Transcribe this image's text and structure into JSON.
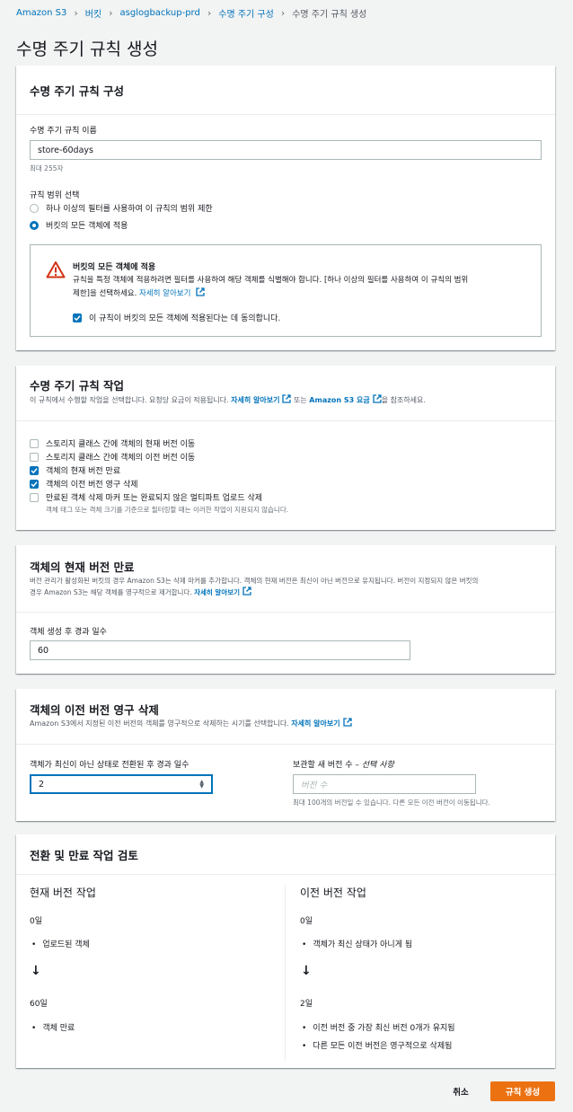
{
  "breadcrumb": [
    {
      "label": "Amazon S3"
    },
    {
      "label": "버킷"
    },
    {
      "label": "asglogbackup-prd"
    },
    {
      "label": "수명 주기 구성"
    },
    {
      "label": "수명 주기 규칙 생성"
    }
  ],
  "page_title": "수명 주기 규칙 생성",
  "config": {
    "title": "수명 주기 규칙 구성",
    "name_label": "수명 주기 규칙 이름",
    "name_value": "store-60days",
    "name_hint": "최대 255자",
    "scope_label": "규칙 범위 선택",
    "scope_options": [
      {
        "label": "하나 이상의 필터를 사용하여 이 규칙의 범위 제한",
        "selected": false
      },
      {
        "label": "버킷의 모든 객체에 적용",
        "selected": true
      }
    ],
    "warning": {
      "title": "버킷의 모든 객체에 적용",
      "body_line1": "규칙을 특정 객체에 적용하려면 필터를 사용하여 해당 객체를 식별해야 합니다. [하나 이상의 필터를 사용하여 이 규칙의 범위",
      "body_line2": "제한]을 선택하세요.",
      "link": "자세히 알아보기",
      "ack_label": "이 규칙이 버킷의 모든 객체에 적용된다는 데 동의합니다.",
      "ack_checked": true
    }
  },
  "actions": {
    "title": "수명 주기 규칙 작업",
    "desc_pre": "이 규칙에서 수행할 작업을 선택합니다. 요청당 요금이 적용됩니다.",
    "desc_link1": "자세히 알아보기",
    "desc_mid": "또는",
    "desc_link2": "Amazon S3 요금",
    "desc_post": "을 참조하세요.",
    "items": [
      {
        "label": "스토리지 클래스 간에 객체의 현재 버전 이동",
        "checked": false
      },
      {
        "label": "스토리지 클래스 간에 객체의 이전 버전 이동",
        "checked": false
      },
      {
        "label": "객체의 현재 버전 만료",
        "checked": true
      },
      {
        "label": "객체의 이전 버전 영구 삭제",
        "checked": true
      },
      {
        "label": "만료된 객체 삭제 마커 또는 완료되지 않은 멀티파트 업로드 삭제",
        "checked": false
      }
    ],
    "items_hint": "객체 태그 또는 객체 크기를 기준으로 필터링할 때는 이러한 작업이 지원되지 않습니다."
  },
  "expire": {
    "title": "객체의 현재 버전 만료",
    "desc_line1": "버전 관리가 활성화된 버킷의 경우 Amazon S3는 삭제 마커를 추가합니다. 객체의 현재 버전은 최신이 아닌 버전으로 유지됩니다. 버전이 지정되지 않은 버킷의",
    "desc_line2": "경우 Amazon S3는 해당 객체를 영구적으로 제거합니다.",
    "desc_link": "자세히 알아보기",
    "days_label": "객체 생성 후 경과 일수",
    "days_value": "60"
  },
  "noncurrent": {
    "title": "객체의 이전 버전 영구 삭제",
    "desc": "Amazon S3에서 지정된 이전 버전의 객체를 영구적으로 삭제하는 시기를 선택합니다.",
    "desc_link": "자세히 알아보기",
    "days_label": "객체가 최신이 아닌 상태로 전환된 후 경과 일수",
    "days_value": "2",
    "keep_label": "보관할 새 버전 수 –",
    "keep_optional": "선택 사항",
    "keep_placeholder": "버전 수",
    "keep_hint": "최대 100개의 버전일 수 있습니다. 다른 모든 이전 버전이 이동됩니다."
  },
  "review": {
    "title": "전환 및 만료 작업 검토",
    "current": {
      "heading": "현재 버전 작업",
      "step1_day": "0일",
      "step1_items": [
        "업로드된 객체"
      ],
      "step2_day": "60일",
      "step2_items": [
        "객체 만료"
      ]
    },
    "previous": {
      "heading": "이전 버전 작업",
      "step1_day": "0일",
      "step1_items": [
        "객체가 최신 상태가 아니게 됨"
      ],
      "step2_day": "2일",
      "step2_items": [
        "이전 버전 중 가장 최신 버전 0개가 유지됨",
        "다른 모든 이전 버전은 영구적으로 삭제됨"
      ]
    }
  },
  "footer": {
    "cancel": "취소",
    "create": "규칙 생성"
  },
  "colors": {
    "accent": "#0073bb",
    "primary_button": "#ec7211",
    "warning": "#d13212"
  }
}
